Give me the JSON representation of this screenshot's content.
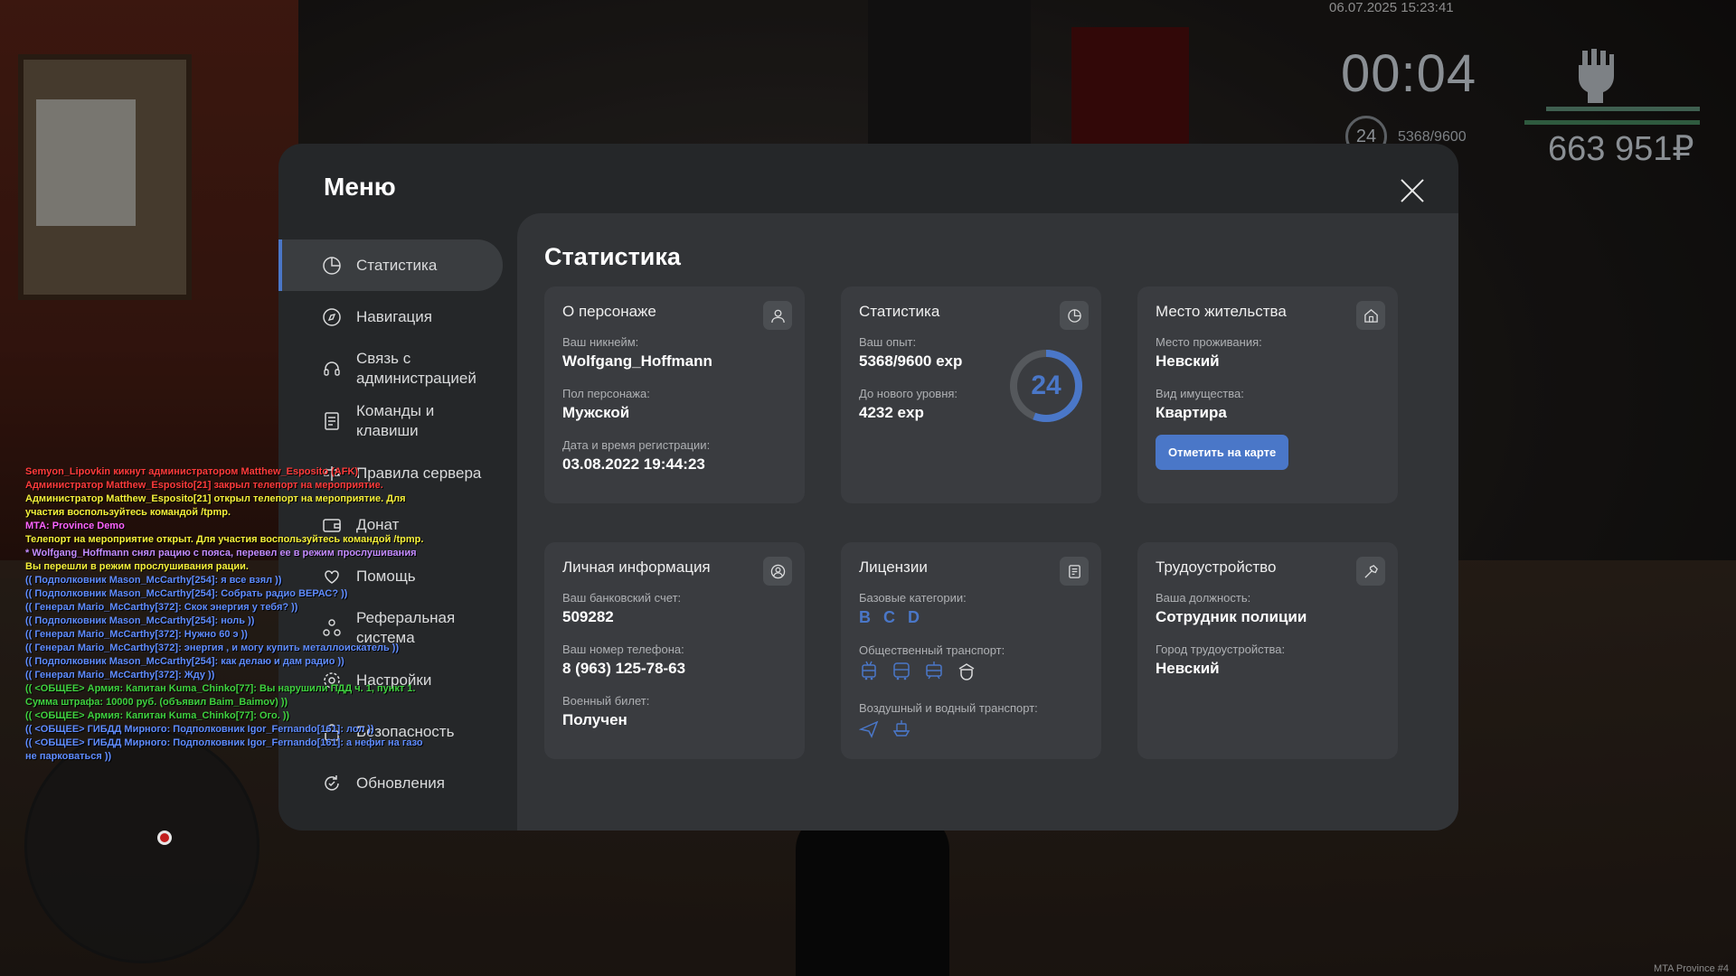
{
  "hud": {
    "datetime": "06.07.2025 15:23:41",
    "timer": "00:04",
    "level": "24",
    "exp": "5368/9600",
    "money": "663 951₽",
    "watermark": "MTA Province #4"
  },
  "chat": [
    {
      "text": "Semyon_Lipovkin кикнут администратором Matthew_Esposito (AFK)",
      "color": "red"
    },
    {
      "text": "Администратор Matthew_Esposito[21] закрыл телепорт на мероприятие.",
      "color": "red"
    },
    {
      "text": "Администратор Matthew_Esposito[21] открыл телепорт на мероприятие. Для",
      "color": "yellow"
    },
    {
      "text": " участия воспользуйтесь командой /tpmp.",
      "color": "yellow"
    },
    {
      "text": "MTA: Province Demo",
      "color": "pink"
    },
    {
      "text": "Телепорт на мероприятие открыт. Для участия воспользуйтесь командой /tpmp.",
      "color": "yellow"
    },
    {
      "text": "* Wolfgang_Hoffmann снял рацию с пояса, перевел ее в режим прослушивания",
      "color": "purple"
    },
    {
      "text": "Вы перешли в режим прослушивания рации.",
      "color": "yellow"
    },
    {
      "text": "(( Подполковник Mason_McCarthy[254]: я все взял ))",
      "color": "blue"
    },
    {
      "text": "(( Подполковник Mason_McCarthy[254]: Собрать радио ВЕРАС? ))",
      "color": "blue"
    },
    {
      "text": "(( Генерал Mario_McCarthy[372]: Скок энергия у тебя? ))",
      "color": "blue"
    },
    {
      "text": "(( Подполковник Mason_McCarthy[254]: ноль ))",
      "color": "blue"
    },
    {
      "text": "(( Генерал Mario_McCarthy[372]: Нужно 60 э ))",
      "color": "blue"
    },
    {
      "text": "(( Генерал Mario_McCarthy[372]: энергия , и могу купить металлоискатель ))",
      "color": "blue"
    },
    {
      "text": "(( Подполковник Mason_McCarthy[254]: как делаю и дам радио ))",
      "color": "blue"
    },
    {
      "text": "(( Генерал Mario_McCarthy[372]: Жду ))",
      "color": "blue"
    },
    {
      "text": "(( <ОБЩЕЕ> Армия: Капитан Kuma_Chinko[77]: Вы нарушили ПДД ч. 1, пункт 1.",
      "color": "green"
    },
    {
      "text": "Сумма штрафа: 10000 руб. (объявил Baim_Baimov) ))",
      "color": "green"
    },
    {
      "text": "(( <ОБЩЕЕ> Армия: Капитан Kuma_Chinko[77]: Ого. ))",
      "color": "green"
    },
    {
      "text": "(( <ОБЩЕЕ> ГИБДД Мирного: Подполковник Igor_Fernando[161]: лол ))",
      "color": "blue"
    },
    {
      "text": "(( <ОБЩЕЕ> ГИБДД Мирного: Подполковник Igor_Fernando[161]: а нефиг на газо",
      "color": "blue"
    },
    {
      "text": "не парковаться ))",
      "color": "blue"
    }
  ],
  "menu": {
    "title": "Меню",
    "sidebar": [
      {
        "label": "Статистика",
        "icon": "pie-chart-icon",
        "active": true
      },
      {
        "label": "Навигация",
        "icon": "compass-icon"
      },
      {
        "label": "Связь с администрацией",
        "icon": "headset-icon"
      },
      {
        "label": "Команды и клавиши",
        "icon": "document-icon"
      },
      {
        "label": "Правила сервера",
        "icon": "rules-icon"
      },
      {
        "label": "Донат",
        "icon": "wallet-icon"
      },
      {
        "label": "Помощь",
        "icon": "heart-hand-icon"
      },
      {
        "label": "Реферальная система",
        "icon": "referral-icon"
      },
      {
        "label": "Настройки",
        "icon": "gear-icon"
      },
      {
        "label": "Безопасность",
        "icon": "lock-icon"
      },
      {
        "label": "Обновления",
        "icon": "refresh-icon"
      }
    ],
    "content_title": "Статистика",
    "cards": {
      "character": {
        "title": "О персонаже",
        "nick_label": "Ваш никнейм:",
        "nick": "Wolfgang_Hoffmann",
        "gender_label": "Пол персонажа:",
        "gender": "Мужской",
        "reg_label": "Дата и время регистрации:",
        "reg": "03.08.2022 19:44:23"
      },
      "stats": {
        "title": "Статистика",
        "exp_label": "Ваш опыт:",
        "exp": "5368/9600 exp",
        "next_label": "До нового уровня:",
        "next": "4232 exp",
        "level": "24",
        "progress": 0.559
      },
      "residence": {
        "title": "Место жительства",
        "place_label": "Место проживания:",
        "place": "Невский",
        "property_label": "Вид имущества:",
        "property": "Квартира",
        "button": "Отметить на карте"
      },
      "personal": {
        "title": "Личная информация",
        "bank_label": "Ваш банковский счет:",
        "bank": "509282",
        "phone_label": "Ваш номер телефона:",
        "phone": "8 (963) 125-78-63",
        "military_label": "Военный билет:",
        "military": "Получен"
      },
      "licenses": {
        "title": "Лицензии",
        "basic_label": "Базовые категории:",
        "categories": [
          "B",
          "C",
          "D"
        ],
        "public_label": "Общественный транспорт:",
        "public_icons": [
          "trolleybus-icon",
          "bus-icon",
          "tram-icon",
          "taxi-icon"
        ],
        "air_label": "Воздушный и водный транспорт:",
        "air_icons": [
          "plane-icon",
          "boat-icon"
        ]
      },
      "job": {
        "title": "Трудоустройство",
        "position_label": "Ваша должность:",
        "position": "Сотрудник полиции",
        "city_label": "Город трудоустройства:",
        "city": "Невский"
      }
    }
  },
  "colors": {
    "accent": "#4a77c8",
    "panel": "#252729",
    "content": "#323437",
    "card": "#3a3c40"
  }
}
